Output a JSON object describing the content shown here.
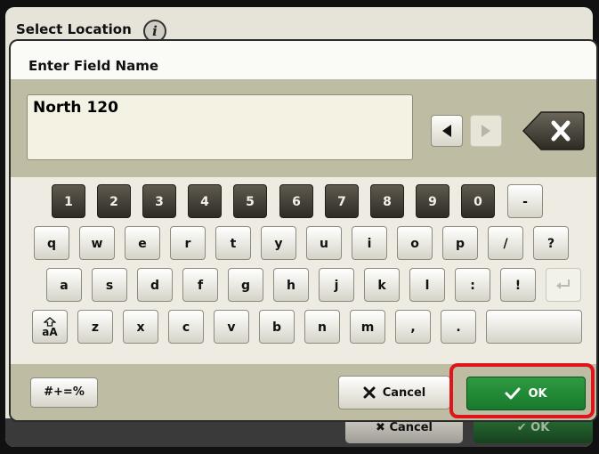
{
  "background_screen": {
    "title": "Select Location",
    "info_icon": "info-icon",
    "cancel_label": "Cancel",
    "ok_label": "OK"
  },
  "dialog": {
    "title": "Enter Field Name",
    "field_value": "North 120",
    "icons": {
      "left_arrow": "arrow-left-icon",
      "right_arrow": "arrow-right-icon",
      "backspace": "backspace-icon",
      "enter": "enter-icon",
      "shift": "shift-case-icon",
      "cancel": "x-icon",
      "ok": "checkmark-icon"
    }
  },
  "keyboard": {
    "row1": [
      "1",
      "2",
      "3",
      "4",
      "5",
      "6",
      "7",
      "8",
      "9",
      "0",
      "-"
    ],
    "row2": [
      "q",
      "w",
      "e",
      "r",
      "t",
      "y",
      "u",
      "i",
      "o",
      "p",
      "/",
      "?"
    ],
    "row3": [
      "a",
      "s",
      "d",
      "f",
      "g",
      "h",
      "j",
      "k",
      "l",
      ":",
      "!"
    ],
    "row4": [
      "z",
      "x",
      "c",
      "v",
      "b",
      "n",
      "m",
      ",",
      "."
    ],
    "shift_label": "aA",
    "symbols_label": "#+=%"
  },
  "actions": {
    "cancel_label": "Cancel",
    "ok_label": "OK"
  },
  "colors": {
    "ok_green": "#1f8a33",
    "highlight_red": "#e0151b",
    "band_khaki": "#bebca2",
    "number_key_dark": "#3b3830"
  }
}
